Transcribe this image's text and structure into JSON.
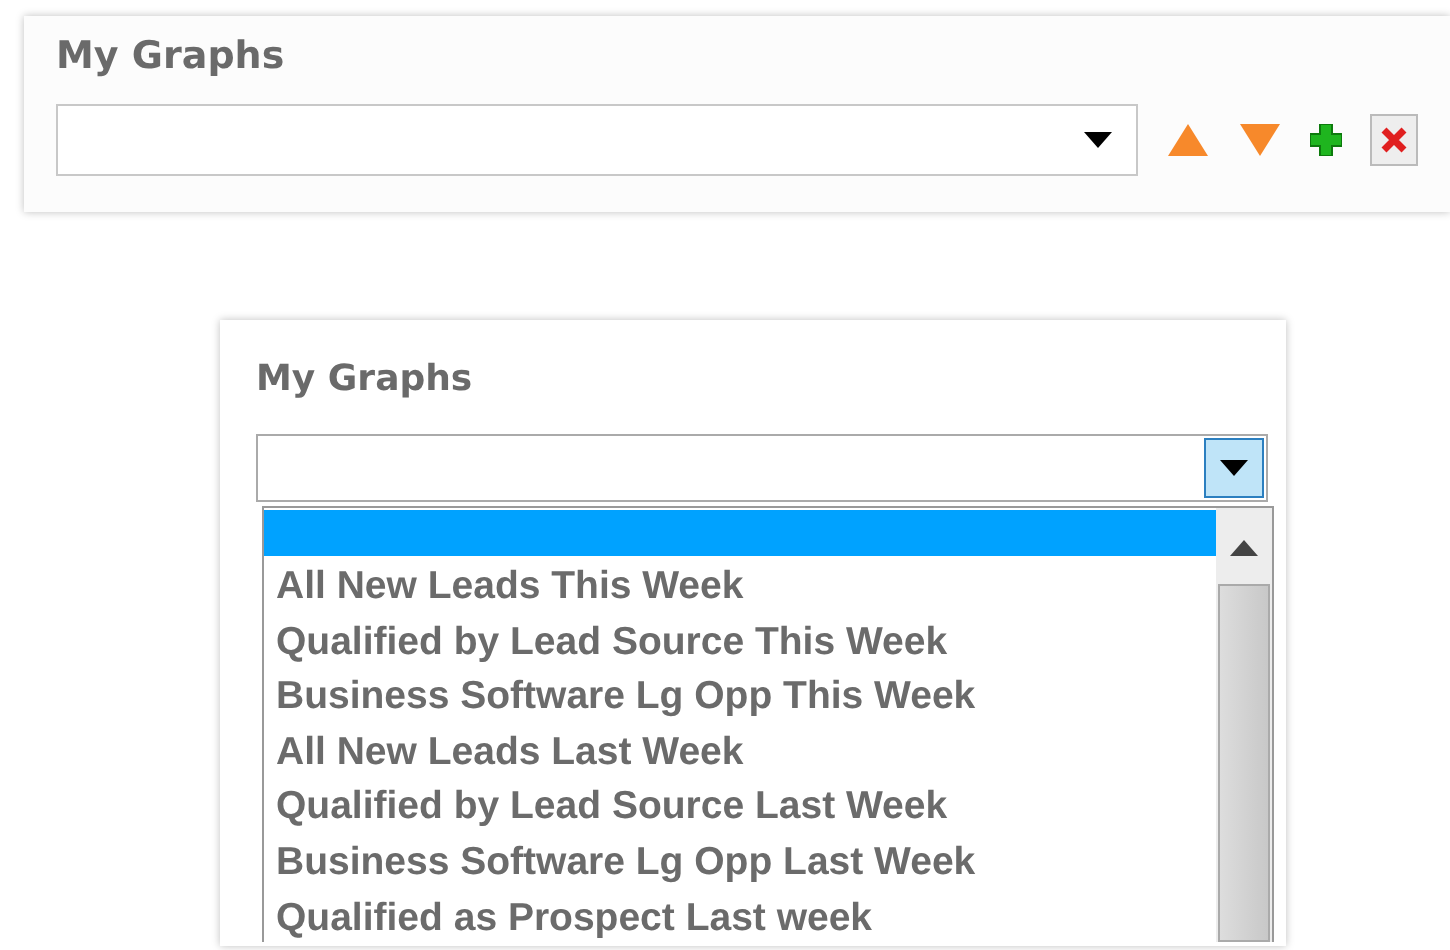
{
  "panels": [
    {
      "title": "My Graphs",
      "dropdown": {
        "expanded": false
      },
      "tools": [
        {
          "kind": "move-up"
        },
        {
          "kind": "move-down"
        },
        {
          "kind": "add"
        },
        {
          "kind": "delete"
        }
      ]
    },
    {
      "title": "My Graphs",
      "dropdown": {
        "expanded": true,
        "options": [
          {
            "selected": true
          },
          {
            "label": "All New Leads This Week",
            "selected": false
          },
          {
            "label": "Qualified by Lead Source This Week",
            "selected": false
          },
          {
            "label": "Business Software Lg Opp This Week",
            "selected": false
          },
          {
            "label": "All New Leads Last Week",
            "selected": false
          },
          {
            "label": "Qualified by Lead Source Last Week",
            "selected": false
          },
          {
            "label": "Business Software Lg Opp Last Week",
            "selected": false
          },
          {
            "label": "Qualified as Prospect Last week",
            "selected": false
          }
        ]
      }
    }
  ]
}
